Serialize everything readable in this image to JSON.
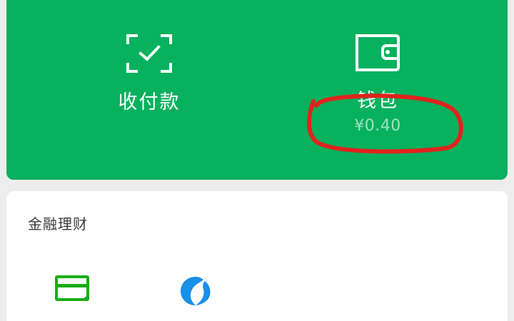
{
  "wallet_panel": {
    "pay": {
      "label": "收付款",
      "icon": "scan-check-icon"
    },
    "wallet": {
      "label": "钱包",
      "amount": "¥0.40",
      "icon": "wallet-icon"
    }
  },
  "finance": {
    "title": "金融理财",
    "items": [
      {
        "icon": "credit-card-icon"
      },
      {
        "icon": "wealth-swirl-icon"
      }
    ]
  },
  "colors": {
    "brand_green": "#07b15e",
    "annotation_red": "#e0231c",
    "card_icon_green": "#1aad19",
    "card_icon_blue": "#1a8fe8"
  }
}
